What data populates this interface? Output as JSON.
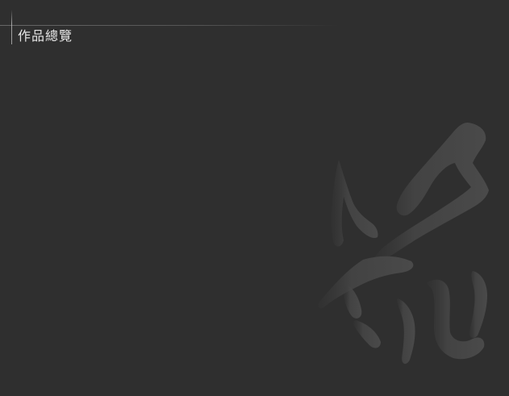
{
  "header": {
    "title": "作品總覽"
  },
  "colors": {
    "background": "#2f2f2f",
    "title_text": "#e6e6e6",
    "watermark": "#4a4a4a"
  },
  "decoration": {
    "watermark_icon": "calligraphy-brush-stroke"
  }
}
